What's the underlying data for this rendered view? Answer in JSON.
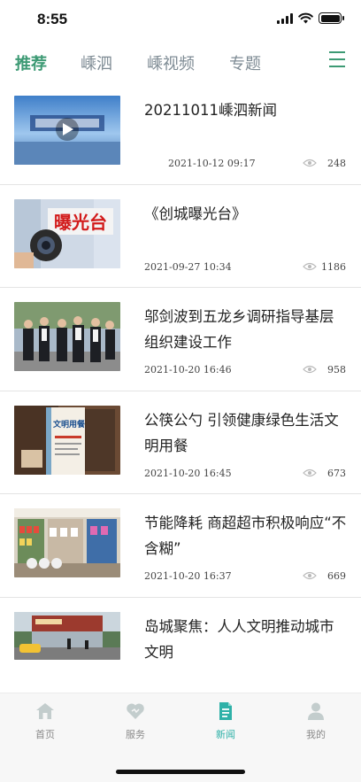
{
  "status_bar": {
    "time": "8:55"
  },
  "colors": {
    "accent": "#3d9a74",
    "nav_active": "#2fb1a8",
    "inactive": "#b5c2c2"
  },
  "tabs": [
    {
      "label": "推荐",
      "active": true
    },
    {
      "label": "嵊泗",
      "active": false
    },
    {
      "label": "嵊视频",
      "active": false
    },
    {
      "label": "专题",
      "active": false
    }
  ],
  "news": [
    {
      "title": "20211011嵊泗新闻",
      "date": "2021-10-12 09:17",
      "views": "248",
      "thumb_icon": "video-play-icon"
    },
    {
      "title": "《创城曝光台》",
      "date": "2021-09-27 10:34",
      "views": "1186",
      "thumb_text": "曝光台"
    },
    {
      "title": "邬剑波到五龙乡调研指导基层组织建设工作",
      "date": "2021-10-20 16:46",
      "views": "958"
    },
    {
      "title": "公筷公勺 引领健康绿色生活文明用餐",
      "date": "2021-10-20 16:45",
      "views": "673",
      "thumb_text": "文明用餐"
    },
    {
      "title": "节能降耗 商超超市积极响应“不含糊”",
      "date": "2021-10-20 16:37",
      "views": "669"
    },
    {
      "title": "岛城聚焦：人人文明推动城市文明"
    }
  ],
  "bottom_nav": [
    {
      "label": "首页",
      "icon": "home-icon",
      "active": false
    },
    {
      "label": "服务",
      "icon": "heart-icon",
      "active": false
    },
    {
      "label": "新闻",
      "icon": "news-icon",
      "active": true
    },
    {
      "label": "我的",
      "icon": "user-icon",
      "active": false
    }
  ]
}
